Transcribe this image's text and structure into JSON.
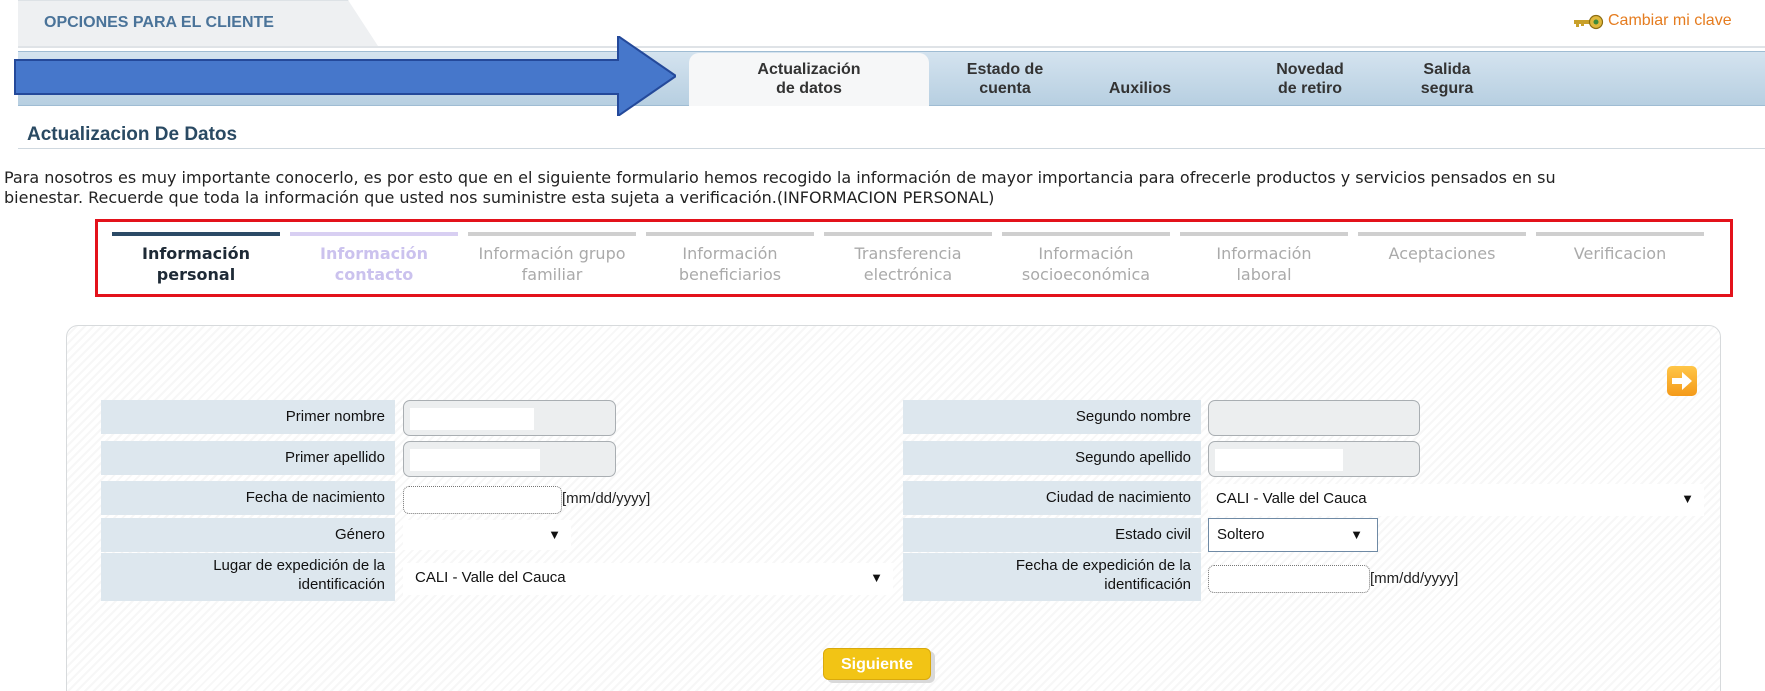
{
  "header": {
    "section_tab": "OPCIONES PARA EL CLIENTE",
    "change_key_link": "Cambiar mi clave"
  },
  "nav": {
    "items": [
      {
        "line1": "Actualización",
        "line2": "de datos",
        "active": true
      },
      {
        "line1": "Estado de",
        "line2": "cuenta"
      },
      {
        "line1": "",
        "line2": "Auxilios"
      },
      {
        "line1": "Novedad",
        "line2": "de retiro"
      },
      {
        "line1": "Salida",
        "line2": "segura"
      }
    ]
  },
  "page": {
    "title": "Actualizacion De Datos",
    "intro_line1": "Para nosotros es muy importante conocerlo, es por esto que en el siguiente formulario hemos recogido la información de mayor importancia para ofrecerle productos y servicios pensados en su",
    "intro_line2": "bienestar. Recuerde que toda la información que usted nos suministre esta sujeta a verificación.(INFORMACION PERSONAL)"
  },
  "steps": [
    {
      "line1": "Información",
      "line2": "personal",
      "state": "active"
    },
    {
      "line1": "Información",
      "line2": "contacto",
      "state": "next"
    },
    {
      "line1": "Información grupo",
      "line2": "familiar",
      "state": "pending"
    },
    {
      "line1": "Información",
      "line2": "beneficiarios",
      "state": "pending"
    },
    {
      "line1": "Transferencia",
      "line2": "electrónica",
      "state": "pending"
    },
    {
      "line1": "Información",
      "line2": "socioeconómica",
      "state": "pending"
    },
    {
      "line1": "Información",
      "line2": "laboral",
      "state": "pending"
    },
    {
      "line1": "Aceptaciones",
      "line2": "",
      "state": "pending"
    },
    {
      "line1": "Verificacion",
      "line2": "",
      "state": "pending"
    }
  ],
  "form": {
    "primer_nombre": {
      "label": "Primer nombre",
      "value": ""
    },
    "segundo_nombre": {
      "label": "Segundo nombre",
      "value": ""
    },
    "primer_apellido": {
      "label": "Primer apellido",
      "value": ""
    },
    "segundo_apellido": {
      "label": "Segundo apellido",
      "value": ""
    },
    "fecha_nacimiento": {
      "label": "Fecha de nacimiento",
      "value": "",
      "hint": "[mm/dd/yyyy]"
    },
    "ciudad_nacimiento": {
      "label": "Ciudad de nacimiento",
      "value": "CALI - Valle del Cauca"
    },
    "genero": {
      "label": "Género",
      "value": ""
    },
    "estado_civil": {
      "label": "Estado civil",
      "value": "Soltero"
    },
    "lugar_expedicion": {
      "label_line1": "Lugar de expedición de la",
      "label_line2": "identificación",
      "value": "CALI - Valle del Cauca"
    },
    "fecha_expedicion": {
      "label_line1": "Fecha de expedición de la",
      "label_line2": "identificación",
      "value": "",
      "hint": "[mm/dd/yyyy]"
    },
    "next_button": "Siguiente"
  },
  "colors": {
    "accent_orange": "#e57c1f",
    "button_yellow": "#f2c415",
    "step_active": "#2b4a66",
    "highlight_red": "#e3121b"
  }
}
